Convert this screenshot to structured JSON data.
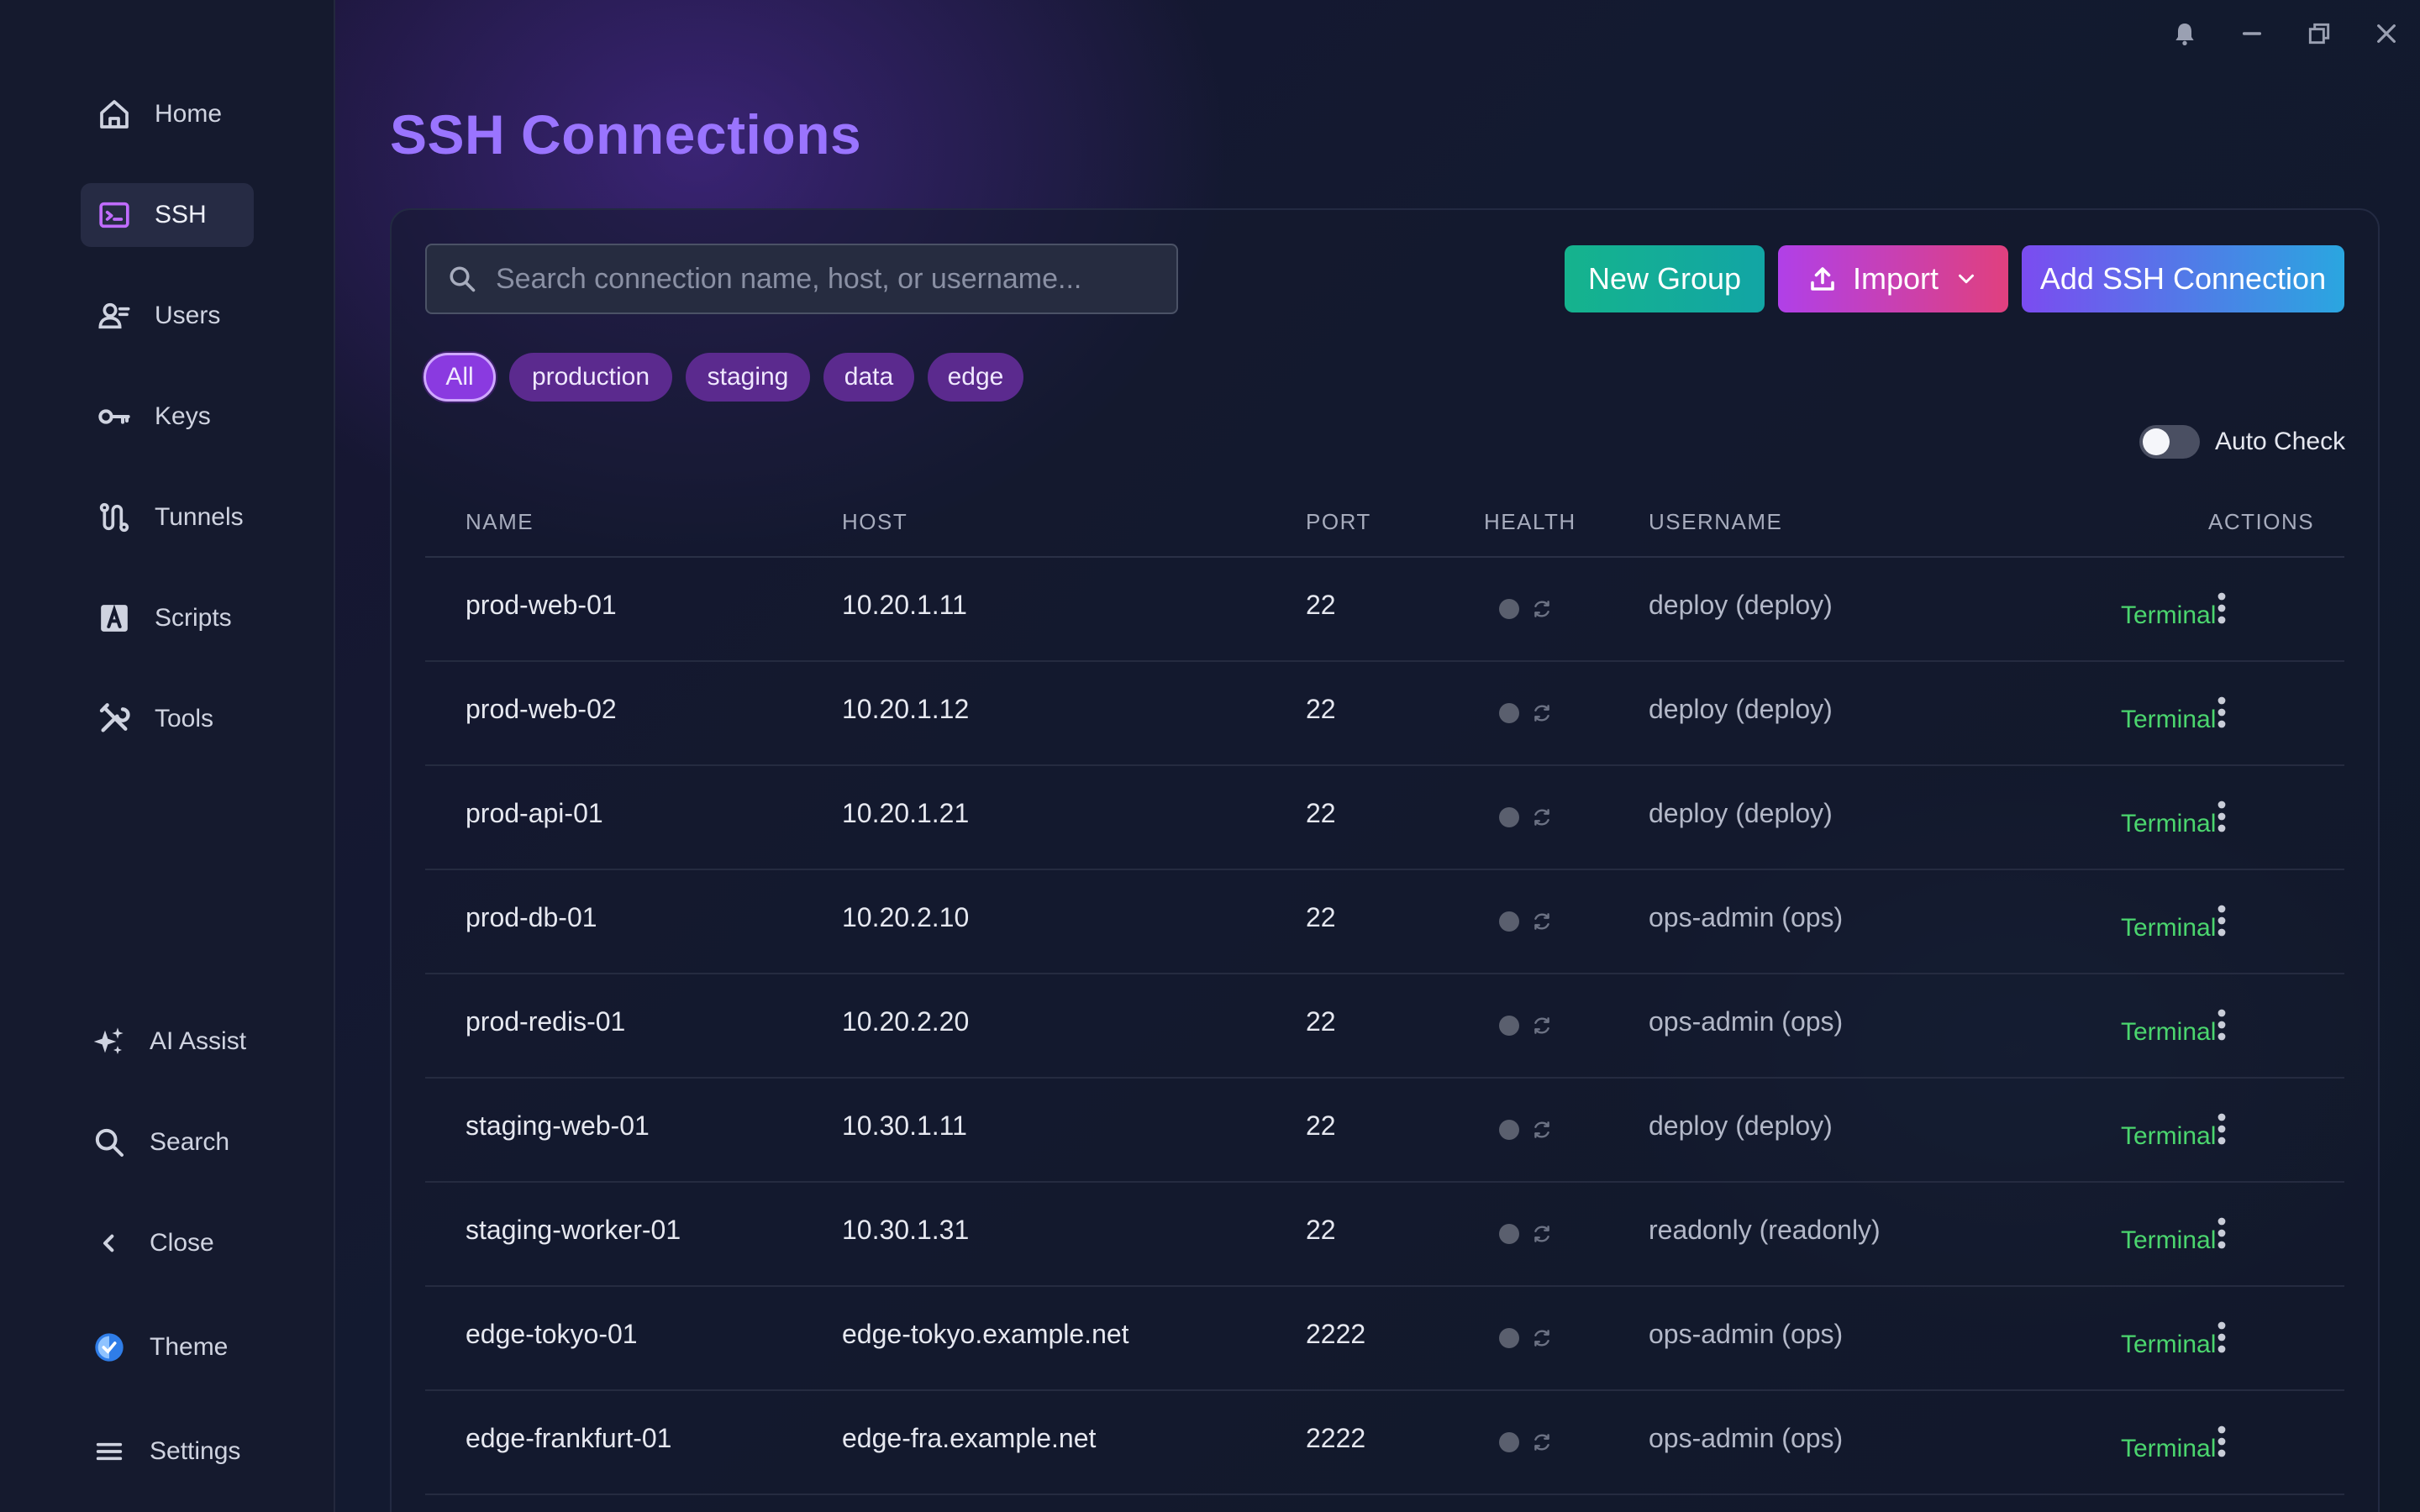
{
  "sidebar": {
    "top_items": [
      {
        "label": "Home",
        "icon": "home-icon"
      },
      {
        "label": "SSH",
        "icon": "terminal-icon",
        "active": true
      },
      {
        "label": "Users",
        "icon": "users-icon"
      },
      {
        "label": "Keys",
        "icon": "key-icon"
      },
      {
        "label": "Tunnels",
        "icon": "tunnel-icon"
      },
      {
        "label": "Scripts",
        "icon": "script-icon"
      },
      {
        "label": "Tools",
        "icon": "tools-icon"
      }
    ],
    "bottom_items": [
      {
        "label": "AI Assist",
        "icon": "sparkle-icon"
      },
      {
        "label": "Search",
        "icon": "search-icon"
      },
      {
        "label": "Close",
        "icon": "chevron-left-icon"
      },
      {
        "label": "Theme",
        "icon": "theme-icon"
      },
      {
        "label": "Settings",
        "icon": "menu-icon"
      }
    ]
  },
  "window_controls": [
    "bell-icon",
    "minimize-icon",
    "restore-icon",
    "close-icon"
  ],
  "page": {
    "title": "SSH Connections"
  },
  "search": {
    "placeholder": "Search connection name, host, or username..."
  },
  "actions": {
    "new_group": "New Group",
    "import": "Import",
    "add": "Add SSH Connection"
  },
  "filters": [
    "All",
    "production",
    "staging",
    "data",
    "edge"
  ],
  "auto_check": {
    "label": "Auto Check",
    "enabled": false
  },
  "table": {
    "headers": {
      "name": "NAME",
      "host": "HOST",
      "port": "PORT",
      "health": "HEALTH",
      "username": "USERNAME",
      "actions": "ACTIONS"
    },
    "terminal_label": "Terminal",
    "rows": [
      {
        "name": "prod-web-01",
        "host": "10.20.1.11",
        "port": "22",
        "username": "deploy (deploy)"
      },
      {
        "name": "prod-web-02",
        "host": "10.20.1.12",
        "port": "22",
        "username": "deploy (deploy)"
      },
      {
        "name": "prod-api-01",
        "host": "10.20.1.21",
        "port": "22",
        "username": "deploy (deploy)"
      },
      {
        "name": "prod-db-01",
        "host": "10.20.2.10",
        "port": "22",
        "username": "ops-admin (ops)"
      },
      {
        "name": "prod-redis-01",
        "host": "10.20.2.20",
        "port": "22",
        "username": "ops-admin (ops)"
      },
      {
        "name": "staging-web-01",
        "host": "10.30.1.11",
        "port": "22",
        "username": "deploy (deploy)"
      },
      {
        "name": "staging-worker-01",
        "host": "10.30.1.31",
        "port": "22",
        "username": "readonly (readonly)"
      },
      {
        "name": "edge-tokyo-01",
        "host": "edge-tokyo.example.net",
        "port": "2222",
        "username": "ops-admin (ops)"
      },
      {
        "name": "edge-frankfurt-01",
        "host": "edge-fra.example.net",
        "port": "2222",
        "username": "ops-admin (ops)"
      }
    ]
  },
  "colors": {
    "accent": "#9a74ff",
    "terminal_link": "#4bd66e",
    "sidebar_bg": "#151a2e"
  }
}
